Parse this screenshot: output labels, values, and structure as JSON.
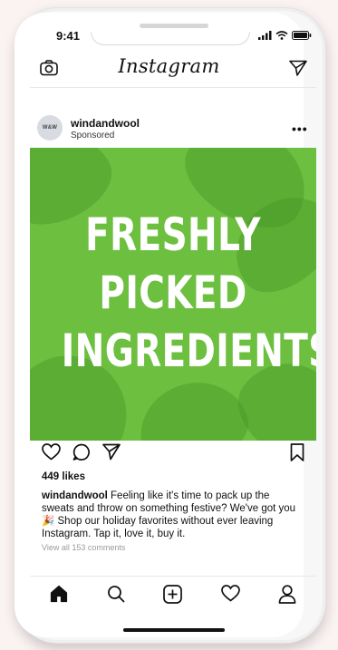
{
  "status_bar": {
    "time": "9:41"
  },
  "header": {
    "app_name": "Instagram",
    "icons": [
      "camera-icon",
      "direct-message-icon"
    ]
  },
  "post": {
    "avatar_text": "W&W",
    "username": "windandwool",
    "sponsored_label": "Sponsored",
    "more_label": "•••",
    "image_text_lines": [
      "FRESHLY",
      "PICKED",
      "INGREDIENTS"
    ],
    "likes": "449 likes",
    "caption_user": "windandwool",
    "caption_text": "Feeling like it's time to pack up the sweats and throw on something festive? We've got you 🎉 Shop our holiday favorites without ever leaving Instagram. Tap it, love it, buy it.",
    "view_comments": "View all 153 comments",
    "action_icons": [
      "heart-icon",
      "comment-icon",
      "share-icon",
      "bookmark-icon"
    ]
  },
  "tab_bar": {
    "items": [
      "home-icon",
      "search-icon",
      "add-post-icon",
      "activity-heart-icon",
      "profile-icon"
    ]
  },
  "colors": {
    "image_bg": "#6cbf3f",
    "text": "#111111",
    "muted": "#9a9a9a",
    "page_bg": "#fbf2f2"
  }
}
